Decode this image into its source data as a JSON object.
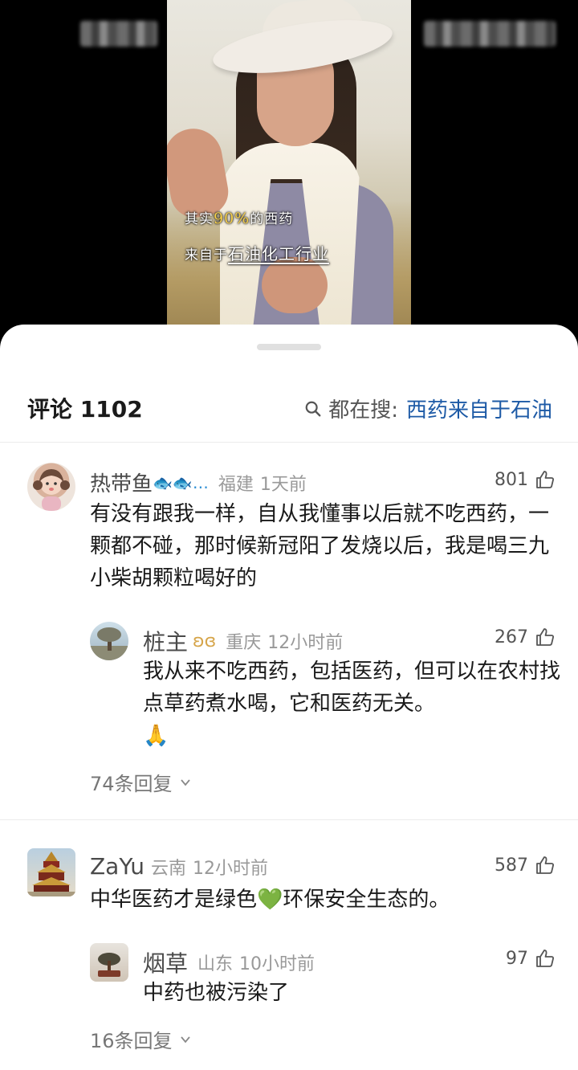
{
  "video": {
    "caption_line1_prefix": "其实",
    "caption_line1_highlight": "90%",
    "caption_line1_suffix": "的西药",
    "caption_line2_prefix": "来自于",
    "caption_line2_emphasis": "石油化工行业"
  },
  "comments_panel": {
    "title": "评论 1102",
    "search_label": "都在搜:",
    "search_topic": "西药来自于石油"
  },
  "comments": [
    {
      "user": "热带鱼",
      "user_emoji": "🐟🐟…",
      "location": "福建",
      "time": "1天前",
      "likes": "801",
      "text": "有没有跟我一样，自从我懂事以后就不吃西药，一颗都不碰，那时候新冠阳了发烧以后，我是喝三九小柴胡颗粒喝好的",
      "reply": {
        "user": "桩主",
        "location": "重庆",
        "time": "12小时前",
        "likes": "267",
        "text": "我从来不吃西药，包括医药，但可以在农村找点草药煮水喝，它和医药无关。",
        "emoji": "🙏"
      },
      "more_replies": "74条回复"
    },
    {
      "user": "ZaYu",
      "location": "云南",
      "time": "12小时前",
      "likes": "587",
      "text_prefix": "中华医药才是绿色",
      "text_emoji": "💚",
      "text_suffix": "环保安全生态的。",
      "reply": {
        "user": "烟草",
        "location": "山东",
        "time": "10小时前",
        "likes": "97",
        "text": "中药也被污染了"
      },
      "more_replies": "16条回复"
    }
  ],
  "icons": {
    "like": "thumb-up-icon",
    "search": "search-icon",
    "expand": "chevron-down-icon"
  },
  "colors": {
    "link_blue": "#1d5aa6",
    "caption_highlight": "#f7d04a"
  }
}
